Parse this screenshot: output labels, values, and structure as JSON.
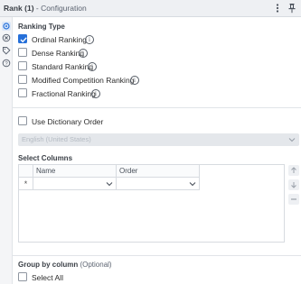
{
  "titlebar": {
    "title": "Rank (1)",
    "subtitle": "- Configuration",
    "menu_icon": "vertical-dots-icon",
    "pin_icon": "pin-icon"
  },
  "leftbar": {
    "icons": [
      "gear-icon",
      "circle-x-icon",
      "tag-icon",
      "question-icon"
    ]
  },
  "ranking": {
    "title": "Ranking Type",
    "options": [
      {
        "label": "Ordinal Ranking",
        "checked": true
      },
      {
        "label": "Dense Ranking",
        "checked": false
      },
      {
        "label": "Standard Ranking",
        "checked": false
      },
      {
        "label": "Modified Competition Ranking",
        "checked": false
      },
      {
        "label": "Fractional Ranking",
        "checked": false
      }
    ],
    "info_glyph": "i"
  },
  "dictionary": {
    "label": "Use Dictionary Order",
    "checked": false,
    "locale_value": "English (United States)"
  },
  "select_columns": {
    "title": "Select Columns",
    "headers": [
      "Name",
      "Order"
    ],
    "row_marker": "*"
  },
  "group_by": {
    "title": "Group by column",
    "optional": "(Optional)",
    "select_all_label": "Select All"
  },
  "colors": {
    "accent": "#2670d9",
    "titlebar_bg": "#eef0f3"
  }
}
